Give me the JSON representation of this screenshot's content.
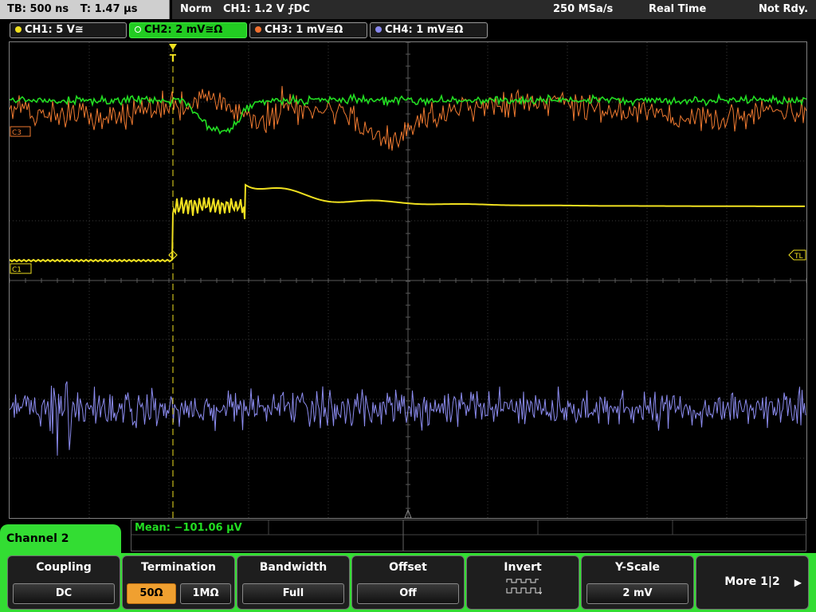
{
  "topbar": {
    "timebase": "TB: 500 ns",
    "trigger_time": "T: 1.47 µs",
    "mode": "Norm",
    "trigger": "CH1: 1.2 V ⨍DC",
    "sample_rate": "250 MSa/s",
    "acquisition": "Real Time",
    "status": "Not Rdy."
  },
  "channels": [
    {
      "label": "CH1: 5 V≅",
      "color": "#f0e020"
    },
    {
      "label": "CH2: 2 mV≅Ω",
      "color": "#22cc22",
      "active": true
    },
    {
      "label": "CH3: 1 mV≅Ω",
      "color": "#f07030"
    },
    {
      "label": "CH4: 1 mV≅Ω",
      "color": "#8888ee"
    }
  ],
  "markers": {
    "c1": "C1",
    "c3": "C3",
    "tl": "TL"
  },
  "measurement": {
    "mean": "Mean: −101.06 µV"
  },
  "menu": {
    "title": "Channel 2",
    "coupling": {
      "label": "Coupling",
      "value": "DC"
    },
    "termination": {
      "label": "Termination",
      "opt1": "50Ω",
      "opt2": "1MΩ"
    },
    "bandwidth": {
      "label": "Bandwidth",
      "value": "Full"
    },
    "offset": {
      "label": "Offset",
      "value": "Off"
    },
    "invert": {
      "label": "Invert"
    },
    "yscale": {
      "label": "Y-Scale",
      "value": "2 mV"
    },
    "more": {
      "label": "More 1|2"
    }
  },
  "colors": {
    "ch1": "#f0e020",
    "ch2": "#22dd22",
    "ch3": "#f07a30",
    "ch4": "#8c8cf0",
    "accent": "#33dd33"
  }
}
